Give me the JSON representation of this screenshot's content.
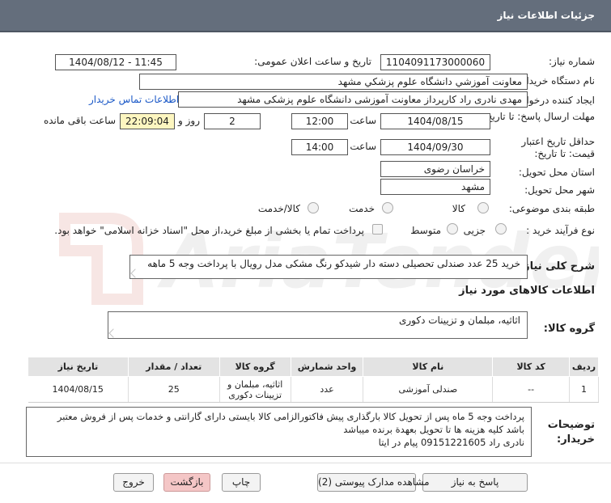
{
  "header": {
    "title": "جزئیات اطلاعات نیاز"
  },
  "watermark": {
    "text": "AriaTender.net"
  },
  "fields": {
    "need_number_label": "شماره نیاز:",
    "need_number": "1104091173000060",
    "announce_label": "تاریخ و ساعت اعلان عمومی:",
    "announce_value": "1404/08/12 - 11:45",
    "buyer_org_label": "نام دستگاه خریدار:",
    "buyer_org": "معاونت آموزشي دانشگاه علوم پزشکي مشهد",
    "creator_label": "ایجاد کننده درخواست:",
    "creator": "مهدی نادری راد کارپرداز معاونت آموزشی دانشگاه علوم پزشکی مشهد",
    "contact_link": "اطلاعات تماس خریدار",
    "deadline_label": "مهلت ارسال پاسخ: تا تاریخ:",
    "deadline_date": "1404/08/15",
    "time_label": "ساعت",
    "deadline_time": "12:00",
    "days": "2",
    "days_label": "روز و",
    "remaining_time": "22:09:04",
    "remaining_label": "ساعت باقی مانده",
    "validity_label": "حداقل تاریخ اعتبار قیمت: تا تاریخ:",
    "validity_date": "1404/09/30",
    "validity_time_label": "ساعت",
    "validity_time": "14:00",
    "province_label": "استان محل تحویل:",
    "province": "خراسان رضوی",
    "city_label": "شهر محل تحویل:",
    "city": "مشهد",
    "category_label": "طبقه بندی موضوعی:",
    "category_options": [
      "کالا",
      "خدمت",
      "کالا/خدمت"
    ],
    "process_label": "نوع فرآیند خرید :",
    "process_options": [
      "جزیی",
      "متوسط"
    ],
    "payment_note": "پرداخت تمام یا بخشی از مبلغ خرید،از محل \"اسناد خزانه اسلامی\" خواهد بود."
  },
  "summary": {
    "label": "شرح کلی نیاز:",
    "text": "خرید 25 عدد صندلی تحصیلی دسته دار شیدکو رنگ مشکی مدل رویال با پرداخت وجه 5 ماهه"
  },
  "goods": {
    "section_title": "اطلاعات کالاهای مورد نیاز",
    "group_label": "گروه کالا:",
    "group_value": "اثاثیه، مبلمان و تزیینات دکوری"
  },
  "table": {
    "headers": [
      "ردیف",
      "کد کالا",
      "نام کالا",
      "واحد شمارش",
      "گروه کالا",
      "تعداد / مقدار",
      "تاریخ نیاز"
    ],
    "rows": [
      [
        "1",
        "--",
        "صندلی آموزشی",
        "عدد",
        "اثاثیه، مبلمان و تزیینات دکوری",
        "25",
        "1404/08/15"
      ]
    ]
  },
  "buyer_notes": {
    "label": "توضیحات خریدار:",
    "lines": [
      "پرداخت وجه 5 ماه پس از تحویل کالا بارگذاری پیش فاکتورالزامی کالا بایستی دارای گارانتی و خدمات پس از فروش معتبر",
      "باشد کلیه هزینه ها تا تحویل بعهدة برنده میباشد",
      "نادری راد 09151221605 پیام در ایتا"
    ]
  },
  "buttons": {
    "reply": "پاسخ به نیاز",
    "attachments": "مشاهده مدارک پیوستی (2)",
    "print": "چاپ",
    "back": "بازگشت",
    "exit": "خروج"
  }
}
